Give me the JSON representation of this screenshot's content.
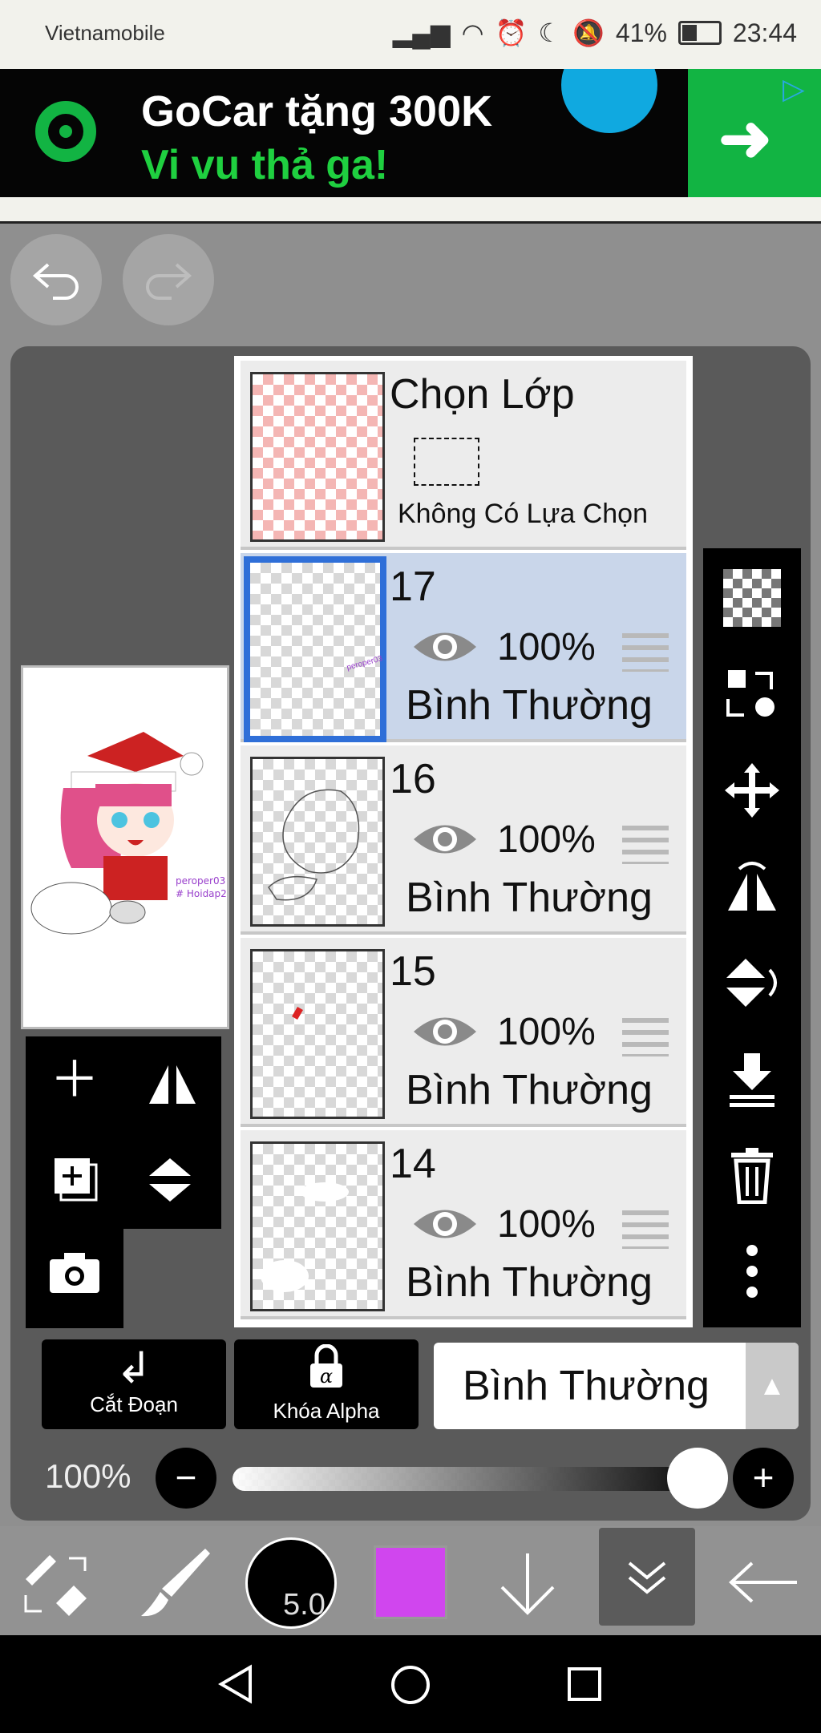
{
  "status_bar": {
    "carrier": "Vietnamobile",
    "battery": "41%",
    "time": "23:44"
  },
  "ad": {
    "headline": "GoCar tặng 300K",
    "subline": "Vi vu thả ga!",
    "colors": {
      "brand_green": "#12b443",
      "accent_blue": "#10a9e0"
    }
  },
  "layer_panel": {
    "selection_layer": {
      "title": "Chọn Lớp",
      "subtitle": "Không Có Lựa Chọn"
    },
    "layers": [
      {
        "name": "17",
        "opacity": "100%",
        "blend": "Bình Thường",
        "selected": true
      },
      {
        "name": "16",
        "opacity": "100%",
        "blend": "Bình Thường",
        "selected": false
      },
      {
        "name": "15",
        "opacity": "100%",
        "blend": "Bình Thường",
        "selected": false
      },
      {
        "name": "14",
        "opacity": "100%",
        "blend": "Bình Thường",
        "selected": false
      }
    ]
  },
  "bottom_controls": {
    "clipping_label": "Cắt Đoạn",
    "alpha_lock_label": "Khóa Alpha",
    "blend_mode": "Bình Thường",
    "opacity": "100%"
  },
  "toolbar": {
    "brush_size": "5.0",
    "current_color": "#d046ee"
  }
}
